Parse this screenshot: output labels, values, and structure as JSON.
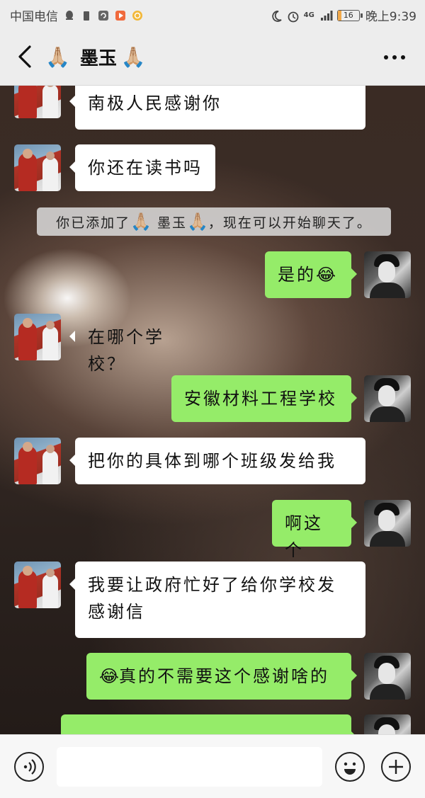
{
  "status_bar": {
    "carrier": "中国电信",
    "network": "4G",
    "battery": "16",
    "battery_level": 0.16,
    "time": "晚上9:39"
  },
  "header": {
    "back_icon": "chevron-left-icon",
    "title_name": "墨玉",
    "title_emoji": "🙏🏼",
    "more_icon": "more-dots-icon"
  },
  "messages": [
    {
      "side": "in",
      "text": "南极人民感谢你"
    },
    {
      "side": "in",
      "text": "你还在读书吗"
    },
    {
      "side": "system",
      "text_before": "你已添加了",
      "name": "墨玉",
      "text_after": "，现在可以开始聊天了。"
    },
    {
      "side": "out",
      "text": "是的",
      "emoji": "😂"
    },
    {
      "side": "in",
      "text": "在哪个学校？"
    },
    {
      "side": "out",
      "text": "安徽材料工程学校"
    },
    {
      "side": "in",
      "text": "把你的具体到哪个班级发给我"
    },
    {
      "side": "out",
      "text": "啊这个"
    },
    {
      "side": "in",
      "text": "我要让政府忙好了给你学校发感谢信"
    },
    {
      "side": "out",
      "text": "真的不需要这个感谢啥的",
      "emoji": "😂"
    }
  ],
  "input_bar": {
    "voice_icon": "voice-icon",
    "emoji_icon": "emoji-icon",
    "plus_icon": "plus-icon"
  },
  "colors": {
    "incoming_bubble": "#ffffff",
    "outgoing_bubble": "#95ec69",
    "header_bg": "#ededed"
  }
}
